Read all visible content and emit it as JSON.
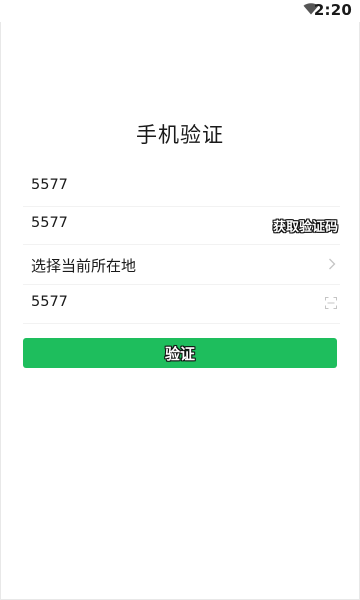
{
  "status_bar": {
    "time": "2:20",
    "wifi_icon": "wifi-icon"
  },
  "title": "手机验证",
  "form": {
    "phone_value": "5577",
    "code_value": "5577",
    "get_code_label": "获取验证码",
    "location_placeholder": "选择当前所在地",
    "location_chevron_icon": "chevron-right-icon",
    "extra_value": "5577",
    "scan_icon": "scan-icon"
  },
  "verify_button": {
    "label": "验证"
  },
  "colors": {
    "accent": "#1ebe5d",
    "text": "#1a1a1a",
    "divider": "#f2f2f2"
  }
}
